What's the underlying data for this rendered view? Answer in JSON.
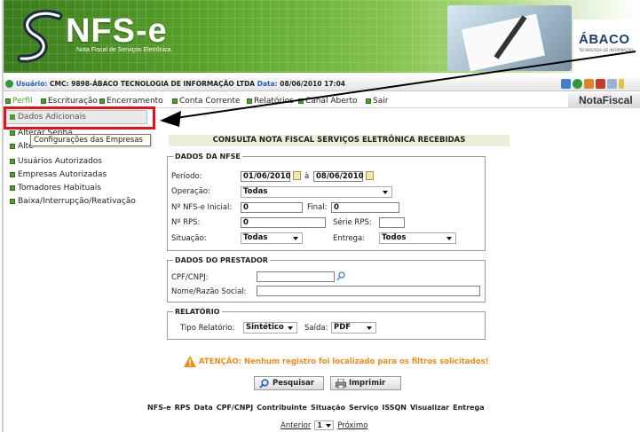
{
  "banner": {
    "title": "NFS-e",
    "subtitle": "Nota Fiscal de Serviços Eletrônica",
    "brand": "ÁBACO",
    "brand_sub": "TECNOLOGIA DE INFORMAÇÃO"
  },
  "userbar": {
    "usuario_label": "Usuário:",
    "usuario_value": "CMC: 9898-ÁBACO TECNOLOGIA DE INFORMAÇÃO LTDA",
    "data_label": "Data:",
    "data_value": "08/06/2010 17:04"
  },
  "menu": {
    "items": [
      "Perfil",
      "Escrituração",
      "Encerramento",
      "Conta Corrente",
      "Relatórios",
      "Canal Aberto",
      "Sair"
    ],
    "nota_fiscal": "NotaFiscal"
  },
  "dropdown": {
    "selected": "Dados Adicionais"
  },
  "sidebar": {
    "items": [
      "Alterar Senha",
      "Alte",
      "Usuários Autorizados",
      "Empresas Autorizadas",
      "Tomadores Habituais",
      "Baixa/Interrupção/Reativação"
    ],
    "tooltip": "Configurações das Empresas"
  },
  "page": {
    "title": "CONSULTA NOTA FISCAL SERVIÇOS ELETRÔNICA RECEBIDAS"
  },
  "dados_nfse": {
    "legend": "DADOS DA NFSE",
    "periodo_label": "Período:",
    "periodo_de": "01/06/2010",
    "periodo_sep": "à",
    "periodo_ate": "08/06/2010",
    "operacao_label": "Operação:",
    "operacao_value": "Todas",
    "nfse_inicial_label": "Nº NFS-e Inicial:",
    "nfse_inicial_value": "0",
    "final_label": "Final:",
    "final_value": "0",
    "rps_label": "Nº RPS:",
    "rps_value": "0",
    "serie_label": "Série RPS:",
    "serie_value": "",
    "situacao_label": "Situação:",
    "situacao_value": "Todas",
    "entrega_label": "Entrega:",
    "entrega_value": "Todos"
  },
  "dados_prestador": {
    "legend": "DADOS DO PRESTADOR",
    "cpf_label": "CPF/CNPJ:",
    "cpf_value": "",
    "nome_label": "Nome/Razão Social:",
    "nome_value": ""
  },
  "relatorio": {
    "legend": "RELATÓRIO",
    "tipo_label": "Tipo Relatório:",
    "tipo_value": "Sintético",
    "saida_label": "Saída:",
    "saida_value": "PDF"
  },
  "alert": {
    "text": "ATENÇÃO: Nenhum registro foi localizado para os filtros solicitados!"
  },
  "buttons": {
    "pesquisar": "Pesquisar",
    "imprimir": "Imprimir"
  },
  "results": {
    "columns": [
      "NFS-e",
      "RPS",
      "Data",
      "CPF/CNPJ",
      "Contribuinte",
      "Situação",
      "Serviço",
      "ISSQN",
      "Visualizar",
      "Entrega"
    ]
  },
  "pager": {
    "prev": "Anterior",
    "page": "1",
    "next": "Próximo"
  },
  "colors": {
    "accent_green": "#4aa12a",
    "alert_orange": "#f08b17",
    "highlight_red": "#e8101b",
    "link_blue": "#1d5fbf"
  }
}
